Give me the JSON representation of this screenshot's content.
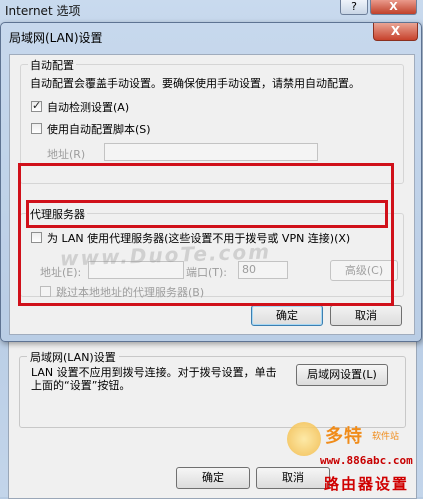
{
  "background_window": {
    "title": "Internet 选项",
    "help_button": "?",
    "close_button": "X",
    "lan_group_label": "局域网(LAN)设置",
    "lan_description": "LAN 设置不应用到拨号连接。对于拨号设置，单击上面的“设置”按钮。",
    "lan_settings_button": "局域网设置(L)",
    "ok_button": "确定",
    "cancel_button": "取消"
  },
  "dialog": {
    "title": "局域网(LAN)设置",
    "close_button": "X",
    "auto_config": {
      "group_label": "自动配置",
      "description": "自动配置会覆盖手动设置。要确保使用手动设置，请禁用自动配置。",
      "auto_detect_label": "自动检测设置(A)",
      "auto_detect_checked": true,
      "use_script_label": "使用自动配置脚本(S)",
      "use_script_checked": false,
      "address_label": "地址(R)",
      "address_value": ""
    },
    "proxy": {
      "group_label": "代理服务器",
      "use_proxy_label": "为 LAN 使用代理服务器(这些设置不用于拨号或 VPN 连接)(X)",
      "use_proxy_checked": false,
      "address_label": "地址(E):",
      "address_value": "",
      "port_label": "端口(T):",
      "port_value": "80",
      "advanced_button": "高级(C)",
      "bypass_label": "跳过本地地址的代理服务器(B)",
      "bypass_checked": false
    },
    "ok_button": "确定",
    "cancel_button": "取消"
  },
  "watermark": "www.DuoTe.com",
  "site_logo_text": "多特",
  "site_logo_subtext": "软件站",
  "site_url": "www.886abc.com",
  "site_brand": "路由器设置",
  "colors": {
    "highlight": "#d0101a",
    "title_bar": "#c7d8ed",
    "url_red": "#c70000"
  }
}
